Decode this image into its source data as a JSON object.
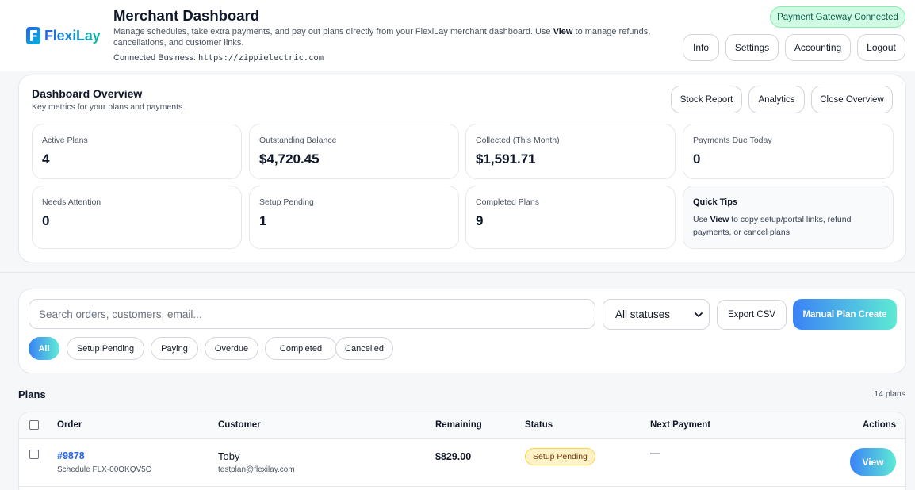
{
  "brand": {
    "name": "FlexiLay"
  },
  "header": {
    "title": "Merchant Dashboard",
    "subtitle_part1": "Manage schedules, take extra payments, and pay out plans directly from your FlexiLay merchant dashboard. Use ",
    "subtitle_bold": "View",
    "subtitle_part2": " to manage refunds, cancellations, and customer links.",
    "connected_label": "Connected Business: ",
    "connected_url": "https://zippielectric.com",
    "gateway_badge": "Payment Gateway Connected",
    "buttons": {
      "info": "Info",
      "settings": "Settings",
      "accounting": "Accounting",
      "logout": "Logout"
    }
  },
  "overview": {
    "title": "Dashboard Overview",
    "subtitle": "Key metrics for your plans and payments.",
    "buttons": {
      "stock_report": "Stock Report",
      "analytics": "Analytics",
      "close": "Close Overview"
    },
    "metrics": [
      {
        "label": "Active Plans",
        "value": "4"
      },
      {
        "label": "Outstanding Balance",
        "value": "$4,720.45"
      },
      {
        "label": "Collected (This Month)",
        "value": "$1,591.71"
      },
      {
        "label": "Payments Due Today",
        "value": "0"
      },
      {
        "label": "Needs Attention",
        "value": "0"
      },
      {
        "label": "Setup Pending",
        "value": "1"
      },
      {
        "label": "Completed Plans",
        "value": "9"
      }
    ],
    "tips": {
      "title": "Quick Tips",
      "text_part1": "Use ",
      "text_bold": "View",
      "text_part2": " to copy setup/portal links, refund payments, or cancel plans."
    }
  },
  "filters": {
    "search_placeholder": "Search orders, customers, email...",
    "status_select": "All statuses",
    "export_label": "Export CSV",
    "create_label": "Manual Plan Create",
    "pills": [
      "All",
      "Setup Pending",
      "Paying",
      "Overdue",
      "Completed",
      "Cancelled"
    ],
    "active_pill": "All"
  },
  "plans": {
    "title": "Plans",
    "count": "14 plans",
    "columns": {
      "order": "Order",
      "customer": "Customer",
      "remaining": "Remaining",
      "status": "Status",
      "next_payment": "Next Payment",
      "actions": "Actions"
    },
    "rows": [
      {
        "order": "#9878",
        "schedule": "Schedule FLX-00OKQV5O",
        "customer_name": "Toby",
        "customer_email": "testplan@flexilay.com",
        "remaining": "$829.00",
        "status": "Setup Pending",
        "next_payment": "—",
        "action": "View"
      }
    ]
  },
  "colors": {
    "accent_start": "#3b82f6",
    "accent_end": "#5eead4",
    "link": "#2563eb",
    "success_bg": "#d1fae5",
    "pending_bg": "#fef3c7"
  }
}
